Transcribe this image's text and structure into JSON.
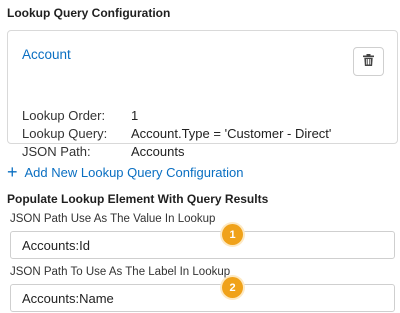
{
  "config_section": {
    "title": "Lookup Query Configuration"
  },
  "card": {
    "title": "Account",
    "delete_icon": "trash-icon",
    "rows": [
      {
        "label": "Lookup Order:",
        "value": "1"
      },
      {
        "label": "Lookup Query:",
        "value": "Account.Type =  'Customer - Direct'"
      },
      {
        "label": "JSON Path:",
        "value": "Accounts"
      }
    ]
  },
  "add_link": {
    "label": "Add New Lookup Query Configuration",
    "icon": "plus-icon"
  },
  "populate_section": {
    "title": "Populate Lookup Element With Query Results",
    "value_field": {
      "label": "JSON Path Use As The Value In Lookup",
      "value": "Accounts:Id",
      "badge": "1"
    },
    "label_field": {
      "label": "JSON Path To Use As The Label In Lookup",
      "value": "Accounts:Name",
      "badge": "2"
    }
  },
  "colors": {
    "link": "#0a6fc2",
    "badge": "#f0a21a",
    "border": "#d9d9d9"
  }
}
